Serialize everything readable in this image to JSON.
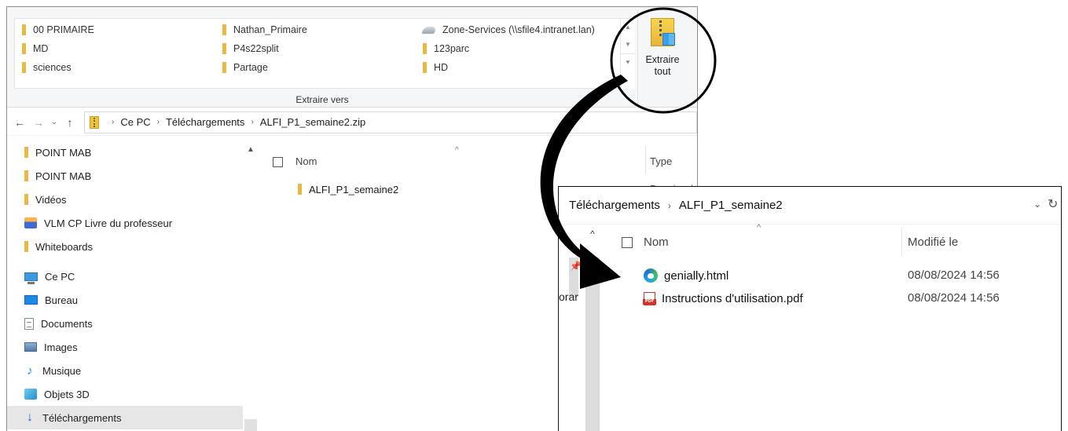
{
  "ribbon": {
    "destinations": [
      {
        "label": "00 PRIMAIRE",
        "icon": "folder-icon"
      },
      {
        "label": "MD",
        "icon": "folder-icon"
      },
      {
        "label": "sciences",
        "icon": "folder-icon"
      },
      {
        "label": "Nathan_Primaire",
        "icon": "folder-icon"
      },
      {
        "label": "P4s22split",
        "icon": "folder-icon"
      },
      {
        "label": "Partage",
        "icon": "folder-icon"
      },
      {
        "label": "Zone-Services (\\\\sfile4.intranet.lan)",
        "icon": "network-drive-icon"
      },
      {
        "label": "123parc",
        "icon": "folder-icon"
      },
      {
        "label": "HD",
        "icon": "folder-icon"
      }
    ],
    "group_label": "Extraire vers",
    "extract_all_line1": "Extraire",
    "extract_all_line2": "tout"
  },
  "address": {
    "crumbs": [
      "Ce PC",
      "Téléchargements",
      "ALFI_P1_semaine2.zip"
    ]
  },
  "nav": {
    "items": [
      {
        "label": "POINT MAB",
        "icon": "folder-icon"
      },
      {
        "label": "POINT MAB",
        "icon": "folder-icon"
      },
      {
        "label": "Vidéos",
        "icon": "folder-icon"
      },
      {
        "label": "VLM CP Livre du professeur",
        "icon": "shortcut-icon"
      },
      {
        "label": "Whiteboards",
        "icon": "folder-icon"
      },
      {
        "label": "Ce PC",
        "icon": "pc-icon"
      },
      {
        "label": "Bureau",
        "icon": "desktop-icon"
      },
      {
        "label": "Documents",
        "icon": "documents-icon"
      },
      {
        "label": "Images",
        "icon": "images-icon"
      },
      {
        "label": "Musique",
        "icon": "music-icon"
      },
      {
        "label": "Objets 3D",
        "icon": "3d-objects-icon"
      },
      {
        "label": "Téléchargements",
        "icon": "downloads-icon",
        "selected": true
      }
    ]
  },
  "content1": {
    "header_name": "Nom",
    "header_type": "Type",
    "files": [
      {
        "name": "ALFI_P1_semaine2",
        "type": "Dossier d"
      }
    ]
  },
  "window2": {
    "crumbs": [
      "Téléchargements",
      "ALFI_P1_semaine2"
    ],
    "nav_fragment": "orar",
    "header_name": "Nom",
    "header_modified": "Modifié le",
    "files": [
      {
        "name": "genially.html",
        "modified": "08/08/2024 14:56",
        "icon": "edge-icon"
      },
      {
        "name": "Instructions d'utilisation.pdf",
        "modified": "08/08/2024 14:56",
        "icon": "pdf-icon"
      }
    ]
  },
  "colors": {
    "accent": "#1e6fd1",
    "folder": "#e8b53a",
    "selection": "#e6e6e6",
    "annotation": "#000000"
  }
}
